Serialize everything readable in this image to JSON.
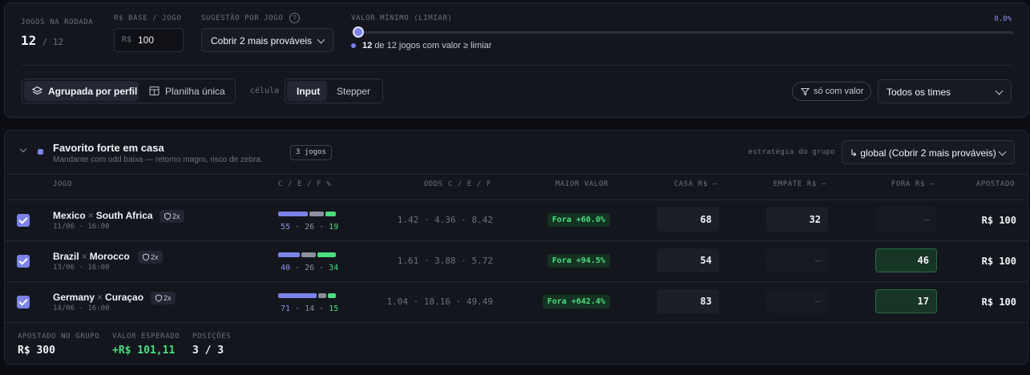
{
  "controls": {
    "games_label": "JOGOS NA RODADA",
    "games_selected": "12",
    "games_total": "/ 12",
    "base_label": "R$ BASE / JOGO",
    "base_prefix": "R$",
    "base_value": "100",
    "suggestion_label": "SUGESTÃO POR JOGO",
    "suggestion_help": "?",
    "suggestion_value": "Cobrir 2 mais prováveis",
    "threshold_label": "VALOR MÍNIMO (LIMIAR)",
    "threshold_value": "0.0%",
    "threshold_level": 0.0,
    "threshold_count": "12",
    "threshold_text": "de 12 jogos com valor ≥ limiar"
  },
  "view": {
    "grouped_label": "Agrupada por perfil",
    "single_label": "Planilha única",
    "cell_label": "célula",
    "input_label": "Input",
    "stepper_label": "Stepper",
    "filter_label": "só com valor",
    "teams_select": "Todos os times"
  },
  "group": {
    "title": "Favorito forte em casa",
    "subtitle": "Mandante com odd baixa — retorno magro, risco de zebra.",
    "count_badge": "3 jogos",
    "strategy_label": "estratégia do grupo",
    "strategy_value": "↳ global (Cobrir 2 mais prováveis)",
    "columns": [
      "JOGO",
      "C / E / F %",
      "ODDS C / E / F",
      "MAIOR VALOR",
      "CASA R$ —",
      "EMPATE R$ —",
      "FORA R$ —",
      "APOSTADO"
    ],
    "rows": [
      {
        "home": "Mexico",
        "sep": "×",
        "away": "South Africa",
        "date": "11/06 · 16:00",
        "mult": "2x",
        "c": 55,
        "e": 26,
        "f": 19,
        "c_txt": "55",
        "e_txt": "26",
        "f_txt": "19",
        "dot1": "·",
        "dot2": "·",
        "odds": "1.42 · 4.36 · 8.42",
        "best": "Fora +60.0%",
        "casa": "68",
        "empate": "32",
        "fora": "–",
        "apostado": "R$ 100"
      },
      {
        "home": "Brazil",
        "sep": "×",
        "away": "Morocco",
        "date": "13/06 · 16:00",
        "mult": "2x",
        "c": 40,
        "e": 26,
        "f": 34,
        "c_txt": "40",
        "e_txt": "26",
        "f_txt": "34",
        "dot1": "·",
        "dot2": "·",
        "odds": "1.61 · 3.88 · 5.72",
        "best": "Fora +94.5%",
        "casa": "54",
        "empate": "–",
        "fora": "46",
        "apostado": "R$ 100"
      },
      {
        "home": "Germany",
        "sep": "×",
        "away": "Curaçao",
        "date": "14/06 · 16:00",
        "mult": "2x",
        "c": 71,
        "e": 14,
        "f": 15,
        "c_txt": "71",
        "e_txt": "14",
        "f_txt": "15",
        "dot1": "·",
        "dot2": "·",
        "odds": "1.04 · 18.16 · 49.49",
        "best": "Fora +642.4%",
        "casa": "83",
        "empate": "–",
        "fora": "17",
        "apostado": "R$ 100"
      }
    ],
    "footer": {
      "bet_label": "APOSTADO NO GRUPO",
      "bet_value": "R$ 300",
      "expected_label": "VALOR ESPERADO",
      "expected_value": "+R$ 101,11",
      "positions_label": "POSIÇÕES",
      "positions_value": "3 / 3"
    }
  },
  "colors": {
    "accent": "#7c83e8",
    "draw": "#8a909c",
    "away": "#4ade80",
    "value_bg": "#163222"
  }
}
